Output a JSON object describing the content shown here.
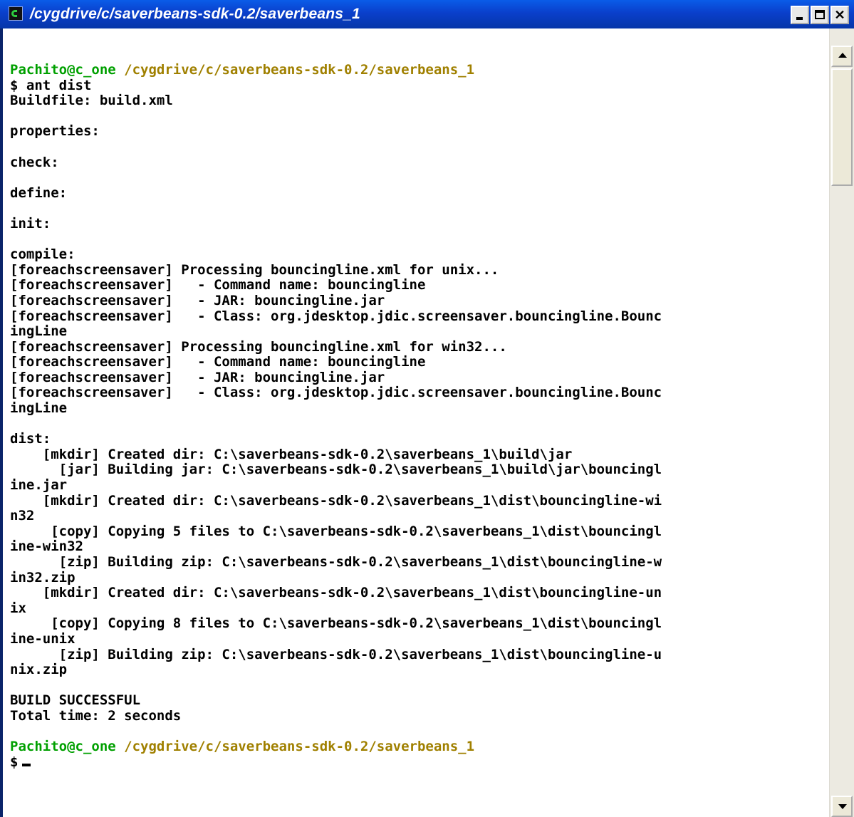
{
  "window": {
    "title": "/cygdrive/c/saverbeans-sdk-0.2/saverbeans_1"
  },
  "terminal": {
    "prompt1_user": "Pachito@c_one",
    "prompt1_path": " /cygdrive/c/saverbeans-sdk-0.2/saverbeans_1",
    "lines": [
      "$ ant dist",
      "Buildfile: build.xml",
      "",
      "properties:",
      "",
      "check:",
      "",
      "define:",
      "",
      "init:",
      "",
      "compile:",
      "[foreachscreensaver] Processing bouncingline.xml for unix...",
      "[foreachscreensaver]   - Command name: bouncingline",
      "[foreachscreensaver]   - JAR: bouncingline.jar",
      "[foreachscreensaver]   - Class: org.jdesktop.jdic.screensaver.bouncingline.Bounc",
      "ingLine",
      "[foreachscreensaver] Processing bouncingline.xml for win32...",
      "[foreachscreensaver]   - Command name: bouncingline",
      "[foreachscreensaver]   - JAR: bouncingline.jar",
      "[foreachscreensaver]   - Class: org.jdesktop.jdic.screensaver.bouncingline.Bounc",
      "ingLine",
      "",
      "dist:",
      "    [mkdir] Created dir: C:\\saverbeans-sdk-0.2\\saverbeans_1\\build\\jar",
      "      [jar] Building jar: C:\\saverbeans-sdk-0.2\\saverbeans_1\\build\\jar\\bouncingl",
      "ine.jar",
      "    [mkdir] Created dir: C:\\saverbeans-sdk-0.2\\saverbeans_1\\dist\\bouncingline-wi",
      "n32",
      "     [copy] Copying 5 files to C:\\saverbeans-sdk-0.2\\saverbeans_1\\dist\\bouncingl",
      "ine-win32",
      "      [zip] Building zip: C:\\saverbeans-sdk-0.2\\saverbeans_1\\dist\\bouncingline-w",
      "in32.zip",
      "    [mkdir] Created dir: C:\\saverbeans-sdk-0.2\\saverbeans_1\\dist\\bouncingline-un",
      "ix",
      "     [copy] Copying 8 files to C:\\saverbeans-sdk-0.2\\saverbeans_1\\dist\\bouncingl",
      "ine-unix",
      "      [zip] Building zip: C:\\saverbeans-sdk-0.2\\saverbeans_1\\dist\\bouncingline-u",
      "nix.zip",
      "",
      "BUILD SUCCESSFUL",
      "Total time: 2 seconds",
      ""
    ],
    "prompt2_user": "Pachito@c_one",
    "prompt2_path": " /cygdrive/c/saverbeans-sdk-0.2/saverbeans_1",
    "final_prompt": "$",
    "colors": {
      "prompt_user": "#00A000",
      "prompt_path": "#A08000",
      "text": "#000000",
      "background": "#FFFFFF"
    }
  }
}
